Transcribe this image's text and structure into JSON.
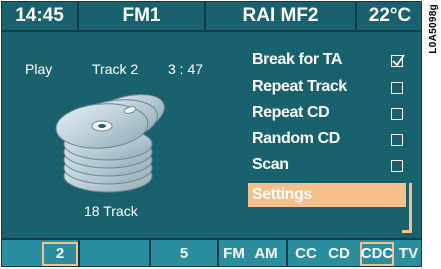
{
  "status": {
    "time": "14:45",
    "band": "FM1",
    "station": "RAI MF2",
    "temperature": "22°C"
  },
  "figure_code": "L0A5098g",
  "player": {
    "mode": "Play",
    "track": "Track 2",
    "elapsed": "3 : 47",
    "stack_label": "18 Track"
  },
  "menu": {
    "items": [
      {
        "label": "Break for TA",
        "checked": true
      },
      {
        "label": "Repeat Track",
        "checked": false
      },
      {
        "label": "Repeat CD",
        "checked": false
      },
      {
        "label": "Random CD",
        "checked": false
      },
      {
        "label": "Scan",
        "checked": false
      }
    ],
    "settings_label": "Settings"
  },
  "softkeys": {
    "key1": "2",
    "key3": "5",
    "fm": "FM",
    "am": "AM",
    "cc": "CC",
    "cd": "CD",
    "cdc": "CDC",
    "tv": "TV"
  },
  "colors": {
    "screen_bg": "#19616c",
    "softkey_bg": "#2b8da0",
    "highlight": "#f6c08d",
    "divider": "#0c3f46"
  },
  "icons": {
    "disc_stack": "cd-stack-icon",
    "checked": "checkmark-icon"
  }
}
